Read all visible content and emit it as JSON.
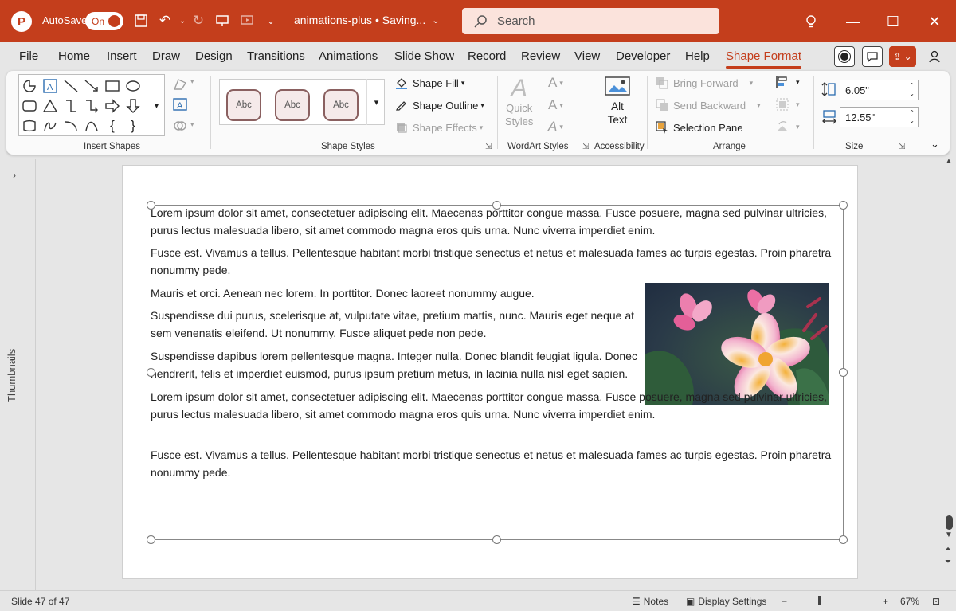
{
  "titlebar": {
    "app_logo": "P",
    "autosave_label": "AutoSave",
    "autosave_state": "On",
    "doc_title": "animations-plus • Saving...",
    "search_placeholder": "Search"
  },
  "tabs": [
    "File",
    "Home",
    "Insert",
    "Draw",
    "Design",
    "Transitions",
    "Animations",
    "Slide Show",
    "Record",
    "Review",
    "View",
    "Developer",
    "Help",
    "Shape Format"
  ],
  "active_tab": "Shape Format",
  "ribbon": {
    "insert_shapes_label": "Insert Shapes",
    "shape_styles_label": "Shape Styles",
    "style_swatch_text": "Abc",
    "shape_fill": "Shape Fill",
    "shape_outline": "Shape Outline",
    "shape_effects": "Shape Effects",
    "quick_styles_line1": "Quick",
    "quick_styles_line2": "Styles",
    "wordart_label": "WordArt Styles",
    "alt_text_line1": "Alt",
    "alt_text_line2": "Text",
    "accessibility_label": "Accessibility",
    "bring_forward": "Bring Forward",
    "send_backward": "Send Backward",
    "selection_pane": "Selection Pane",
    "arrange_label": "Arrange",
    "height_value": "6.05\"",
    "width_value": "12.55\"",
    "size_label": "Size"
  },
  "workspace": {
    "thumbnails_label": "Thumbnails",
    "paragraphs": [
      "Lorem ipsum dolor sit amet, consectetuer adipiscing elit. Maecenas porttitor congue massa. Fusce posuere, magna sed pulvinar ultricies, purus lectus malesuada libero, sit amet commodo magna eros quis urna. Nunc viverra imperdiet enim.",
      "Fusce est. Vivamus a tellus. Pellentesque habitant morbi tristique senectus et netus et malesuada fames ac turpis egestas. Proin pharetra nonummy pede.",
      "Mauris et orci. Aenean nec lorem. In porttitor. Donec laoreet nonummy augue.",
      "Suspendisse dui purus, scelerisque at, vulputate vitae, pretium mattis, nunc. Mauris eget neque at sem venenatis eleifend. Ut nonummy. Fusce aliquet pede non pede.",
      "Suspendisse dapibus lorem pellentesque magna. Integer nulla. Donec blandit feugiat ligula. Donec hendrerit, felis et imperdiet euismod, purus ipsum pretium metus, in lacinia nulla nisl eget sapien.",
      "Lorem ipsum dolor sit amet, consectetuer adipiscing elit. Maecenas porttitor congue massa. Fusce posuere, magna sed pulvinar ultricies, purus lectus malesuada libero, sit amet commodo magna eros quis urna. Nunc viverra imperdiet enim.",
      "Fusce est. Vivamus a tellus. Pellentesque habitant morbi tristique senectus et netus et malesuada fames ac turpis egestas. Proin pharetra nonummy pede."
    ]
  },
  "statusbar": {
    "slide_info": "Slide 47 of 47",
    "notes": "Notes",
    "display_settings": "Display Settings",
    "zoom": "67%"
  },
  "colors": {
    "accent": "#c43e1c",
    "ribbon_bg": "#fafafa",
    "app_bg": "#e6e6e6"
  }
}
